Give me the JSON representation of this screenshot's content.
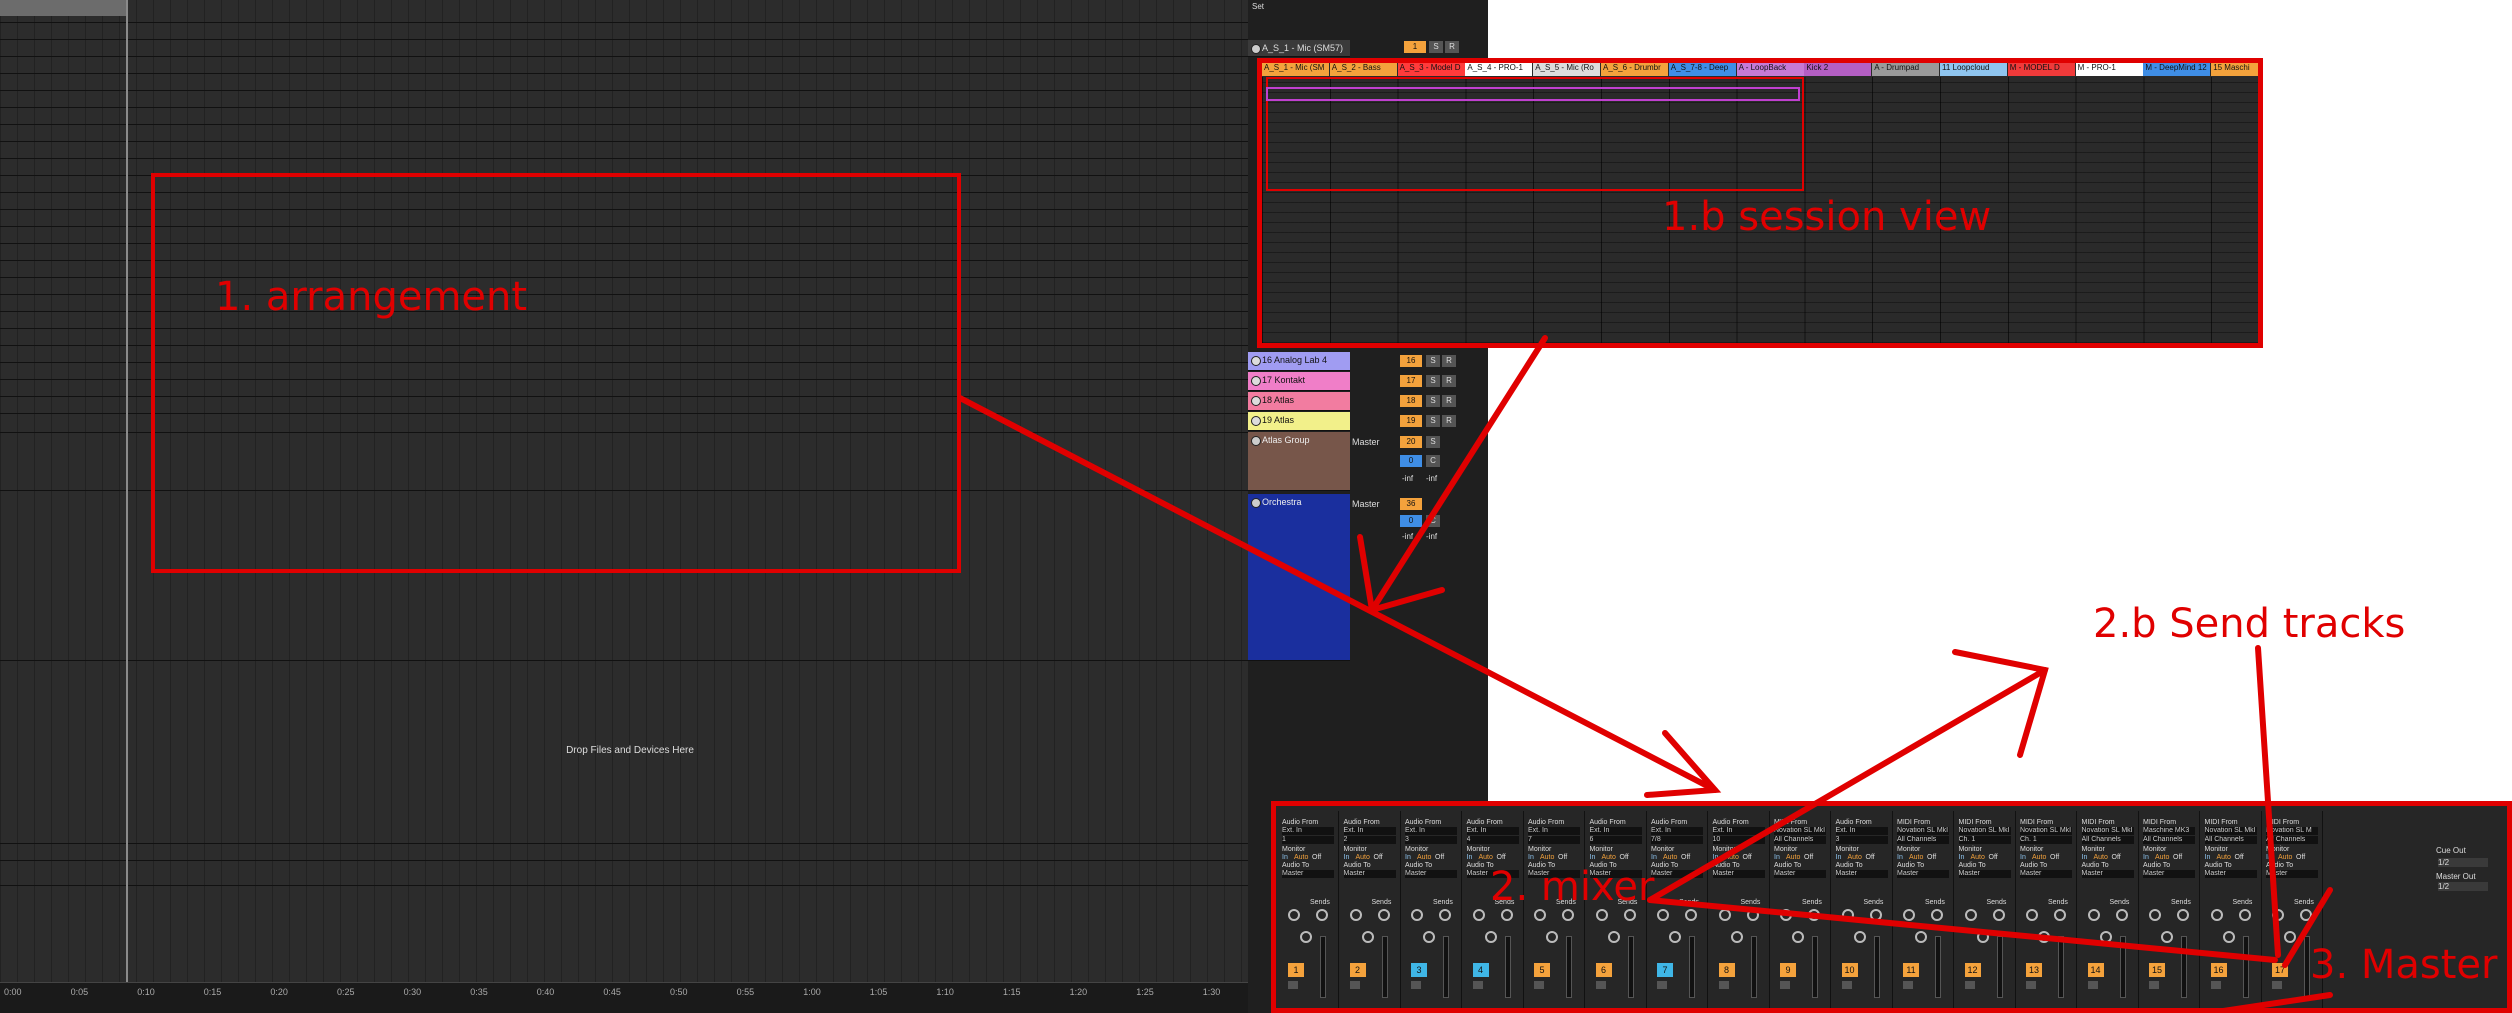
{
  "arrangement": {
    "drop_text": "Drop Files and Devices Here",
    "timeline": [
      "0:00",
      "0:05",
      "0:10",
      "0:15",
      "0:20",
      "0:25",
      "0:30",
      "0:35",
      "0:40",
      "0:45",
      "0:50",
      "0:55",
      "1:00",
      "1:05",
      "1:10",
      "1:15",
      "1:20",
      "1:25",
      "1:30"
    ]
  },
  "top_label": "Set",
  "first_track": {
    "name": "A_S_1 - Mic (SM57)",
    "number": "1",
    "s": "S",
    "r": "R"
  },
  "left_tracks": [
    {
      "name": "16 Analog Lab 4",
      "color": "#a09cf2",
      "number": "16",
      "s": "S",
      "r": "R"
    },
    {
      "name": "17 Kontakt",
      "color": "#f07ec8",
      "number": "17",
      "s": "S",
      "r": "R"
    },
    {
      "name": "18 Atlas",
      "color": "#f27ca0",
      "number": "18",
      "s": "S",
      "r": "R"
    },
    {
      "name": "19 Atlas",
      "color": "#f2f08a",
      "number": "19",
      "s": "S",
      "r": "R"
    }
  ],
  "groups": [
    {
      "name": "Atlas Group",
      "color": "#77564a",
      "output": "Master",
      "number": "20",
      "s": "S",
      "vol": "0",
      "pan": "C",
      "inf1": "-inf",
      "inf2": "-inf"
    },
    {
      "name": "Orchestra",
      "color": "#1a2f9e",
      "output": "Master",
      "number": "36",
      "s": "S",
      "vol": "0",
      "pan": "C",
      "inf1": "-inf",
      "inf2": "-inf"
    }
  ],
  "session": {
    "tracks": [
      {
        "name": "A_S_1 - Mic (SM",
        "color": "#f4a23c"
      },
      {
        "name": "A_S_2 - Bass",
        "color": "#f4a23c"
      },
      {
        "name": "A_S_3 - Model D",
        "color": "#ff3b3b"
      },
      {
        "name": "A_S_4 - PRO-1",
        "color": "#ffffff"
      },
      {
        "name": "A_S_5 - Mic (Ro",
        "color": "#dddddd"
      },
      {
        "name": "A_S_6 - Drumbr",
        "color": "#f4a23c"
      },
      {
        "name": "A_S_7-8 - Deep",
        "color": "#3f8ee6"
      },
      {
        "name": "A - LoopBack",
        "color": "#c67ad6"
      },
      {
        "name": "Kick 2",
        "color": "#b45fc4"
      },
      {
        "name": "A - Drumpad",
        "color": "#9a9a9a"
      },
      {
        "name": "11 Loopcloud",
        "color": "#8fc5ef"
      },
      {
        "name": "M - MODEL D",
        "color": "#f03a3a"
      },
      {
        "name": "M - PRO-1",
        "color": "#ffffff"
      },
      {
        "name": "M - DeepMind 12",
        "color": "#3f8ee6"
      },
      {
        "name": "15 Maschi",
        "color": "#f4a23c"
      }
    ]
  },
  "mixer": {
    "strips": [
      {
        "audio_from": "Audio From",
        "input": "Ext. In",
        "channel": "1",
        "number": "1"
      },
      {
        "audio_from": "Audio From",
        "input": "Ext. In",
        "channel": "2",
        "number": "2"
      },
      {
        "audio_from": "Audio From",
        "input": "Ext. In",
        "channel": "3",
        "number": "3"
      },
      {
        "audio_from": "Audio From",
        "input": "Ext. In",
        "channel": "4",
        "number": "4"
      },
      {
        "audio_from": "Audio From",
        "input": "Ext. In",
        "channel": "7",
        "number": "5"
      },
      {
        "audio_from": "Audio From",
        "input": "Ext. In",
        "channel": "6",
        "number": "6"
      },
      {
        "audio_from": "Audio From",
        "input": "Ext. In",
        "channel": "7/8",
        "number": "7"
      },
      {
        "audio_from": "Audio From",
        "input": "Ext. In",
        "channel": "10",
        "number": "8"
      },
      {
        "audio_from": "MIDI From",
        "input": "Novation SL MkI",
        "channel": "All Channels",
        "number": "9"
      },
      {
        "audio_from": "Audio From",
        "input": "Ext. In",
        "channel": "3",
        "number": "10"
      },
      {
        "audio_from": "MIDI From",
        "input": "Novation SL MkI",
        "channel": "All Channels",
        "number": "11"
      },
      {
        "audio_from": "MIDI From",
        "input": "Novation SL MkI",
        "channel": "Ch. 1",
        "number": "12"
      },
      {
        "audio_from": "MIDI From",
        "input": "Novation SL MkI",
        "channel": "Ch. 1",
        "number": "13"
      },
      {
        "audio_from": "MIDI From",
        "input": "Novation SL MkI",
        "channel": "All Channels",
        "number": "14"
      },
      {
        "audio_from": "MIDI From",
        "input": "Maschine MK3",
        "channel": "All Channels",
        "number": "15"
      },
      {
        "audio_from": "MIDI From",
        "input": "Novation SL MkI",
        "channel": "All Channels",
        "number": "16"
      },
      {
        "audio_from": "MIDI From",
        "input": "Novation SL M",
        "channel": "All Channels",
        "number": "17"
      }
    ],
    "monitor": "Monitor",
    "in": "In",
    "auto": "Auto",
    "off": "Off",
    "audio_to": "Audio To",
    "master": "Master",
    "sends": "Sends",
    "cue_out": "Cue Out",
    "cue_val": "1/2",
    "master_out": "Master Out",
    "master_val": "1/2"
  },
  "annotations": {
    "arrangement": "1. arrangement",
    "session": "1.b session view",
    "send_tracks": "2.b Send tracks",
    "mixer": "2. mixer",
    "master": "3. Master"
  },
  "colors": {
    "annotation_red": "#e00000",
    "clip_orange": "#f4a23c"
  }
}
